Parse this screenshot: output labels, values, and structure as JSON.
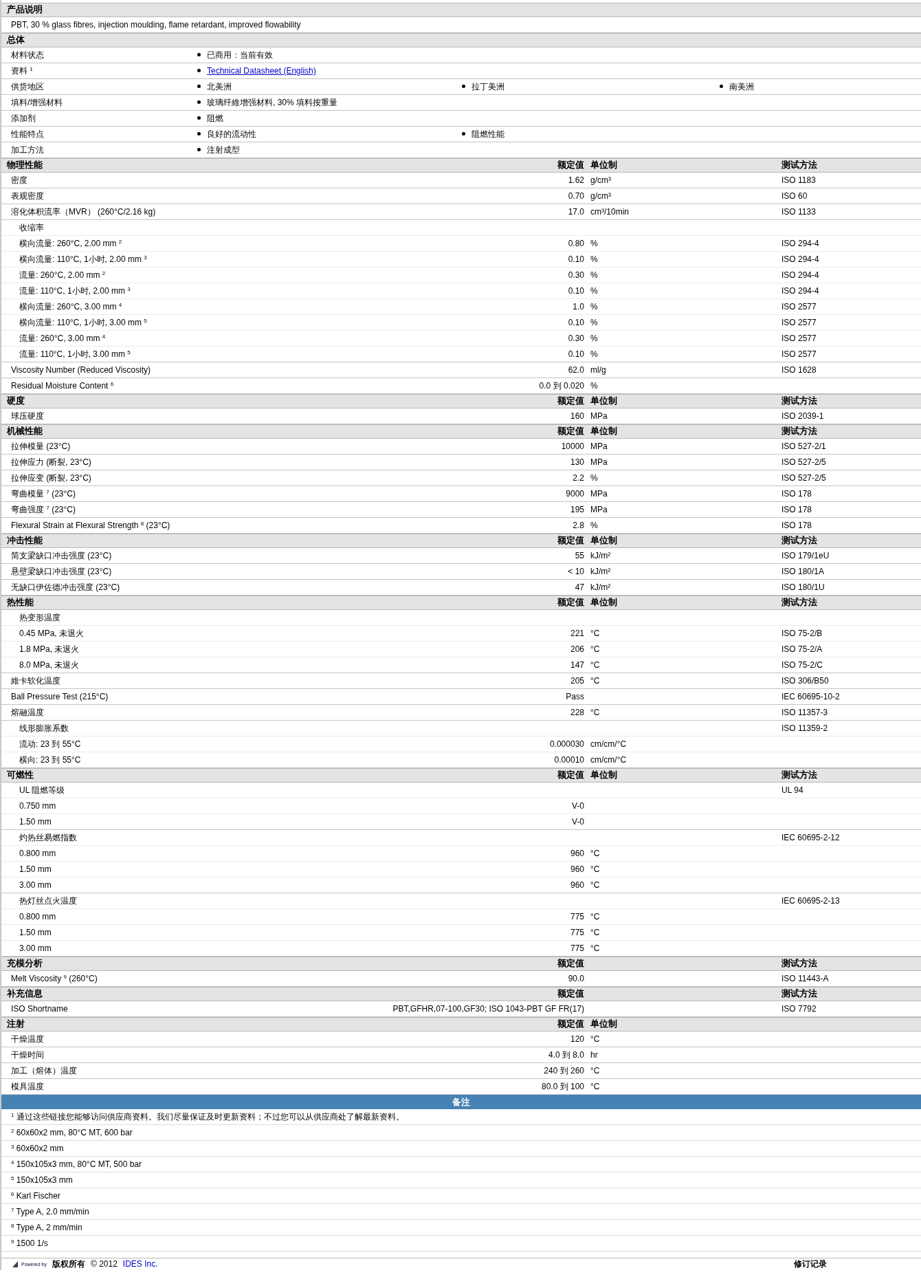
{
  "sections": [
    {
      "kind": "description",
      "title": "产品说明",
      "text": "PBT, 30 % glass fibres, injection moulding, flame retardant, improved flowability"
    },
    {
      "kind": "general",
      "title": "总体",
      "rows": [
        {
          "label": "材料状态",
          "items": [
            {
              "kind": "text",
              "text": "已商用：当前有效"
            }
          ]
        },
        {
          "label": "资料 $^{1}$",
          "items": [
            {
              "kind": "link",
              "text": "Technical Datasheet (English)"
            }
          ]
        },
        {
          "label": "供货地区",
          "items": [
            {
              "kind": "text",
              "text": "北美洲"
            },
            {
              "kind": "text",
              "text": "拉丁美洲"
            },
            {
              "kind": "text",
              "text": "南美洲"
            }
          ]
        },
        {
          "label": "填料/增强材料",
          "items": [
            {
              "kind": "text",
              "text": "玻璃纤維增强材料, 30% 填料按重量"
            }
          ]
        },
        {
          "label": "添加剂",
          "items": [
            {
              "kind": "text",
              "text": "阻燃"
            }
          ]
        },
        {
          "label": "性能特点",
          "items": [
            {
              "kind": "text",
              "text": "良好的流动性"
            },
            {
              "kind": "text",
              "text": "阻燃性能"
            }
          ]
        },
        {
          "label": "加工方法",
          "items": [
            {
              "kind": "text",
              "text": "注射成型"
            }
          ]
        }
      ]
    },
    {
      "kind": "properties",
      "title": "物理性能",
      "value_header": "额定值",
      "unit_header": "单位制",
      "method_header": "测试方法",
      "rows": [
        {
          "label": "密度",
          "value": "1.62",
          "unit": "g/cm³",
          "method": "ISO 1183"
        },
        {
          "label": "表观密度",
          "value": "0.70",
          "unit": "g/cm³",
          "method": "ISO 60"
        },
        {
          "label": "溶化体积流率（MVR） (260°C/2.16 kg)",
          "value": "17.0",
          "unit": "cm³/10min",
          "method": "ISO 1133"
        },
        {
          "label": "收缩率",
          "children": [
            {
              "label": "横向流量: 260°C, 2.00 mm $^{2}$",
              "value": "0.80",
              "unit": "%",
              "method": "ISO 294-4"
            },
            {
              "label": "横向流量: 110°C, 1小时, 2.00 mm $^{3}$",
              "value": "0.10",
              "unit": "%",
              "method": "ISO 294-4"
            },
            {
              "label": "流量: 260°C, 2.00 mm $^{2}$",
              "value": "0.30",
              "unit": "%",
              "method": "ISO 294-4"
            },
            {
              "label": "流量: 110°C, 1小时, 2.00 mm $^{3}$",
              "value": "0.10",
              "unit": "%",
              "method": "ISO 294-4"
            },
            {
              "label": "横向流量: 260°C, 3.00 mm $^{4}$",
              "value": "1.0",
              "unit": "%",
              "method": "ISO 2577"
            },
            {
              "label": "横向流量: 110°C, 1小时, 3.00 mm $^{5}$",
              "value": "0.10",
              "unit": "%",
              "method": "ISO 2577"
            },
            {
              "label": "流量: 260°C, 3.00 mm $^{4}$",
              "value": "0.30",
              "unit": "%",
              "method": "ISO 2577"
            },
            {
              "label": "流量: 110°C, 1小时, 3.00 mm $^{5}$",
              "value": "0.10",
              "unit": "%",
              "method": "ISO 2577"
            }
          ]
        },
        {
          "label": "Viscosity Number (Reduced Viscosity)",
          "value": "62.0",
          "unit": "ml/g",
          "method": "ISO 1628"
        },
        {
          "label": "Residual Moisture Content $^{6}$",
          "value": "0.0 到 0.020",
          "unit": "%"
        }
      ]
    },
    {
      "kind": "properties",
      "title": "硬度",
      "value_header": "额定值",
      "unit_header": "单位制",
      "method_header": "测试方法",
      "rows": [
        {
          "label": "球压硬度",
          "value": "160",
          "unit": "MPa",
          "method": "ISO 2039-1"
        }
      ]
    },
    {
      "kind": "properties",
      "title": "机械性能",
      "value_header": "额定值",
      "unit_header": "单位制",
      "method_header": "测试方法",
      "rows": [
        {
          "label": "拉伸模量 (23°C)",
          "value": "10000",
          "unit": "MPa",
          "method": "ISO 527-2/1"
        },
        {
          "label": "拉伸应力 (断裂, 23°C)",
          "value": "130",
          "unit": "MPa",
          "method": "ISO 527-2/5"
        },
        {
          "label": "拉伸应变 (断裂, 23°C)",
          "value": "2.2",
          "unit": "%",
          "method": "ISO 527-2/5"
        },
        {
          "label": "弯曲模量 $^{7}$ (23°C)",
          "value": "9000",
          "unit": "MPa",
          "method": "ISO 178"
        },
        {
          "label": "弯曲强度 $^{7}$ (23°C)",
          "value": "195",
          "unit": "MPa",
          "method": "ISO 178"
        },
        {
          "label": "Flexural Strain at Flexural Strength $^{8}$ (23°C)",
          "value": "2.8",
          "unit": "%",
          "method": "ISO 178"
        }
      ]
    },
    {
      "kind": "properties",
      "title": "冲击性能",
      "value_header": "额定值",
      "unit_header": "单位制",
      "method_header": "测试方法",
      "rows": [
        {
          "label": "简支梁缺口冲击强度 (23°C)",
          "value": "55",
          "unit": "kJ/m²",
          "method": "ISO 179/1eU"
        },
        {
          "label": "悬壁梁缺口冲击强度 (23°C)",
          "value": "< 10",
          "unit": "kJ/m²",
          "method": "ISO 180/1A"
        },
        {
          "label": "无缺口伊佐德冲击强度 (23°C)",
          "value": "47",
          "unit": "kJ/m²",
          "method": "ISO 180/1U"
        }
      ]
    },
    {
      "kind": "properties",
      "title": "热性能",
      "value_header": "额定值",
      "unit_header": "单位制",
      "method_header": "测试方法",
      "rows": [
        {
          "label": "热变形温度",
          "children": [
            {
              "label": "0.45 MPa, 未退火",
              "value": "221",
              "unit": "°C",
              "method": "ISO 75-2/B"
            },
            {
              "label": "1.8 MPa, 未退火",
              "value": "206",
              "unit": "°C",
              "method": "ISO 75-2/A"
            },
            {
              "label": "8.0 MPa, 未退火",
              "value": "147",
              "unit": "°C",
              "method": "ISO 75-2/C"
            }
          ]
        },
        {
          "label": "維卡软化温度",
          "value": "205",
          "unit": "°C",
          "method": "ISO 306/B50"
        },
        {
          "label": "Ball Pressure Test (215°C)",
          "value": "Pass",
          "method": "IEC 60695-10-2"
        },
        {
          "label": "熔融温度",
          "value": "228",
          "unit": "°C",
          "method": "ISO 11357-3"
        },
        {
          "label": "线形膨胀系数",
          "method": "ISO 11359-2",
          "children": [
            {
              "label": "流动: 23 到 55°C",
              "value": "0.000030",
              "unit": "cm/cm/°C"
            },
            {
              "label": "横向: 23 到 55°C",
              "value": "0.00010",
              "unit": "cm/cm/°C"
            }
          ]
        }
      ]
    },
    {
      "kind": "properties",
      "title": "可燃性",
      "value_header": "额定值",
      "unit_header": "单位制",
      "method_header": "测试方法",
      "rows": [
        {
          "label": "UL 阻燃等级",
          "method": "UL 94",
          "children": [
            {
              "label": "0.750 mm",
              "value": "V-0"
            },
            {
              "label": "1.50 mm",
              "value": "V-0"
            }
          ]
        },
        {
          "label": "灼热丝易燃指数",
          "method": "IEC 60695-2-12",
          "children": [
            {
              "label": "0.800 mm",
              "value": "960",
              "unit": "°C"
            },
            {
              "label": "1.50 mm",
              "value": "960",
              "unit": "°C"
            },
            {
              "label": "3.00 mm",
              "value": "960",
              "unit": "°C"
            }
          ]
        },
        {
          "label": "热灯丝点火温度",
          "method": "IEC 60695-2-13",
          "children": [
            {
              "label": "0.800 mm",
              "value": "775",
              "unit": "°C"
            },
            {
              "label": "1.50 mm",
              "value": "775",
              "unit": "°C"
            },
            {
              "label": "3.00 mm",
              "value": "775",
              "unit": "°C"
            }
          ]
        }
      ]
    },
    {
      "kind": "properties",
      "title": "充模分析",
      "value_header": "额定值",
      "method_header": "测试方法",
      "rows": [
        {
          "label": "Melt Viscosity $^{9}$ (260°C)",
          "value": "90.0",
          "method": "ISO 11443-A"
        }
      ]
    },
    {
      "kind": "properties",
      "title": "补充信息",
      "value_header": "额定值",
      "method_header": "测试方法",
      "rows": [
        {
          "label": "ISO Shortname",
          "value": "PBT,GFHR,07-100,GF30; ISO 1043-PBT GF FR(17)",
          "method": "ISO 7792"
        }
      ]
    },
    {
      "kind": "properties",
      "title": "注射",
      "value_header": "额定值",
      "unit_header": "单位制",
      "rows": [
        {
          "label": "干燥温度",
          "value": "120",
          "unit": "°C"
        },
        {
          "label": "干燥时间",
          "value": "4.0 到 8.0",
          "unit": "hr"
        },
        {
          "label": "加工（熔体）温度",
          "value": "240 到 260",
          "unit": "°C"
        },
        {
          "label": "模具温度",
          "value": "80.0 到 100",
          "unit": "°C"
        }
      ]
    },
    {
      "kind": "notes",
      "title": "备注",
      "items": [
        {
          "mark": "1",
          "text": "通过这些链接您能够访问供应商资料。我们尽量保证及时更新资料；不过您可以从供应商处了解最新资料。"
        },
        {
          "mark": "2",
          "text": "60x60x2 mm, 80°C MT, 600 bar"
        },
        {
          "mark": "3",
          "text": "60x60x2 mm"
        },
        {
          "mark": "4",
          "text": "150x105x3 mm, 80°C MT, 500 bar"
        },
        {
          "mark": "5",
          "text": "150x105x3 mm"
        },
        {
          "mark": "6",
          "text": "Karl Fischer"
        },
        {
          "mark": "7",
          "text": "Type A, 2.0 mm/min"
        },
        {
          "mark": "8",
          "text": "Type A, 2 mm/min"
        },
        {
          "mark": "9",
          "text": "1500 1/s"
        }
      ]
    }
  ],
  "footer": {
    "powered_by": "Powered by",
    "copyright": "版权所有",
    "year": "© 2012",
    "company_link": "IDES Inc.",
    "revision": "修订记录"
  }
}
